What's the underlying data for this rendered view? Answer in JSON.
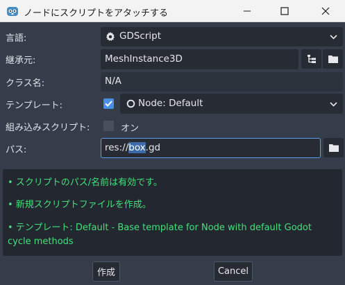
{
  "window": {
    "title": "ノードにスクリプトをアタッチする",
    "icon": "godot-icon"
  },
  "form": {
    "language": {
      "label": "言語:",
      "value": "GDScript",
      "icon": "gear-icon"
    },
    "inherits": {
      "label": "継承元:",
      "value": "MeshInstance3D"
    },
    "class_name": {
      "label": "クラス名:",
      "value": "N/A"
    },
    "template": {
      "label": "テンプレート:",
      "checked": true,
      "value": "Node: Default"
    },
    "builtin": {
      "label": "組み込みスクリプト:",
      "checked": false,
      "value": "オン"
    },
    "path": {
      "label": "パス:",
      "prefix": "res://",
      "selected": "box",
      "suffix": ".gd"
    }
  },
  "messages": [
    "• スクリプトのパス/名前は有効です。",
    "• 新規スクリプトファイルを作成。",
    "• テンプレート: Default - Base template for Node with default Godot cycle methods"
  ],
  "buttons": {
    "create": "作成",
    "cancel": "Cancel"
  },
  "colors": {
    "accent": "#4a90e2",
    "success": "#45e07a",
    "panel": "#363d4a",
    "field": "#262b34"
  }
}
